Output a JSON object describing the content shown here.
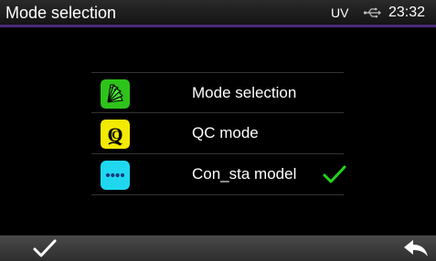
{
  "header": {
    "title": "Mode selection",
    "status_uv": "UV",
    "usb_icon": "usb-icon",
    "clock": "23:32"
  },
  "menu": {
    "items": [
      {
        "label": "Mode selection",
        "icon": "fan-deck-icon",
        "icon_color": "#2ec31a",
        "selected": false
      },
      {
        "label": "QC mode",
        "icon": "qc-icon",
        "icon_color": "#f2ea00",
        "selected": false
      },
      {
        "label": "Con_sta model",
        "icon": "dots-icon",
        "icon_color": "#1fd8f0",
        "selected": true
      }
    ],
    "selected_check_color": "#22d41f"
  },
  "footer": {
    "confirm_icon": "checkmark-icon",
    "back_icon": "back-arrow-icon"
  },
  "colors": {
    "title_accent": "#4a2a7a",
    "divider": "#333333",
    "bar": "#3c3c3c"
  }
}
